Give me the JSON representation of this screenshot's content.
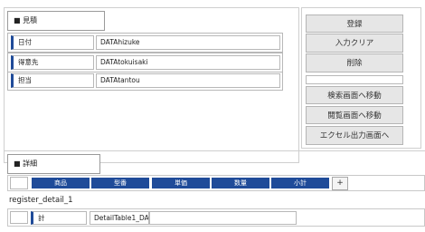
{
  "estimate": {
    "header": "■ 見積",
    "fields": [
      {
        "label": "日付",
        "value": "DATAhizuke"
      },
      {
        "label": "得意先",
        "value": "DATAtokuisaki"
      },
      {
        "label": "担当",
        "value": "DATAtantou"
      }
    ]
  },
  "buttons": {
    "register": "登録",
    "clear": "入力クリア",
    "delete": "削除",
    "search": "検索画面へ移動",
    "browse": "閲覧画面へ移動",
    "excel": "エクセル出力画面へ"
  },
  "detail": {
    "header": "■ 詳細",
    "columns": [
      "商品",
      "型番",
      "単価",
      "数量",
      "小計"
    ],
    "add_label": "+",
    "register_text": "register_detail_1",
    "total_label": "計",
    "total_value": "DetailTable1_DA"
  },
  "colors": {
    "accent": "#1f4b99",
    "button_bg": "#e6e6e6"
  }
}
